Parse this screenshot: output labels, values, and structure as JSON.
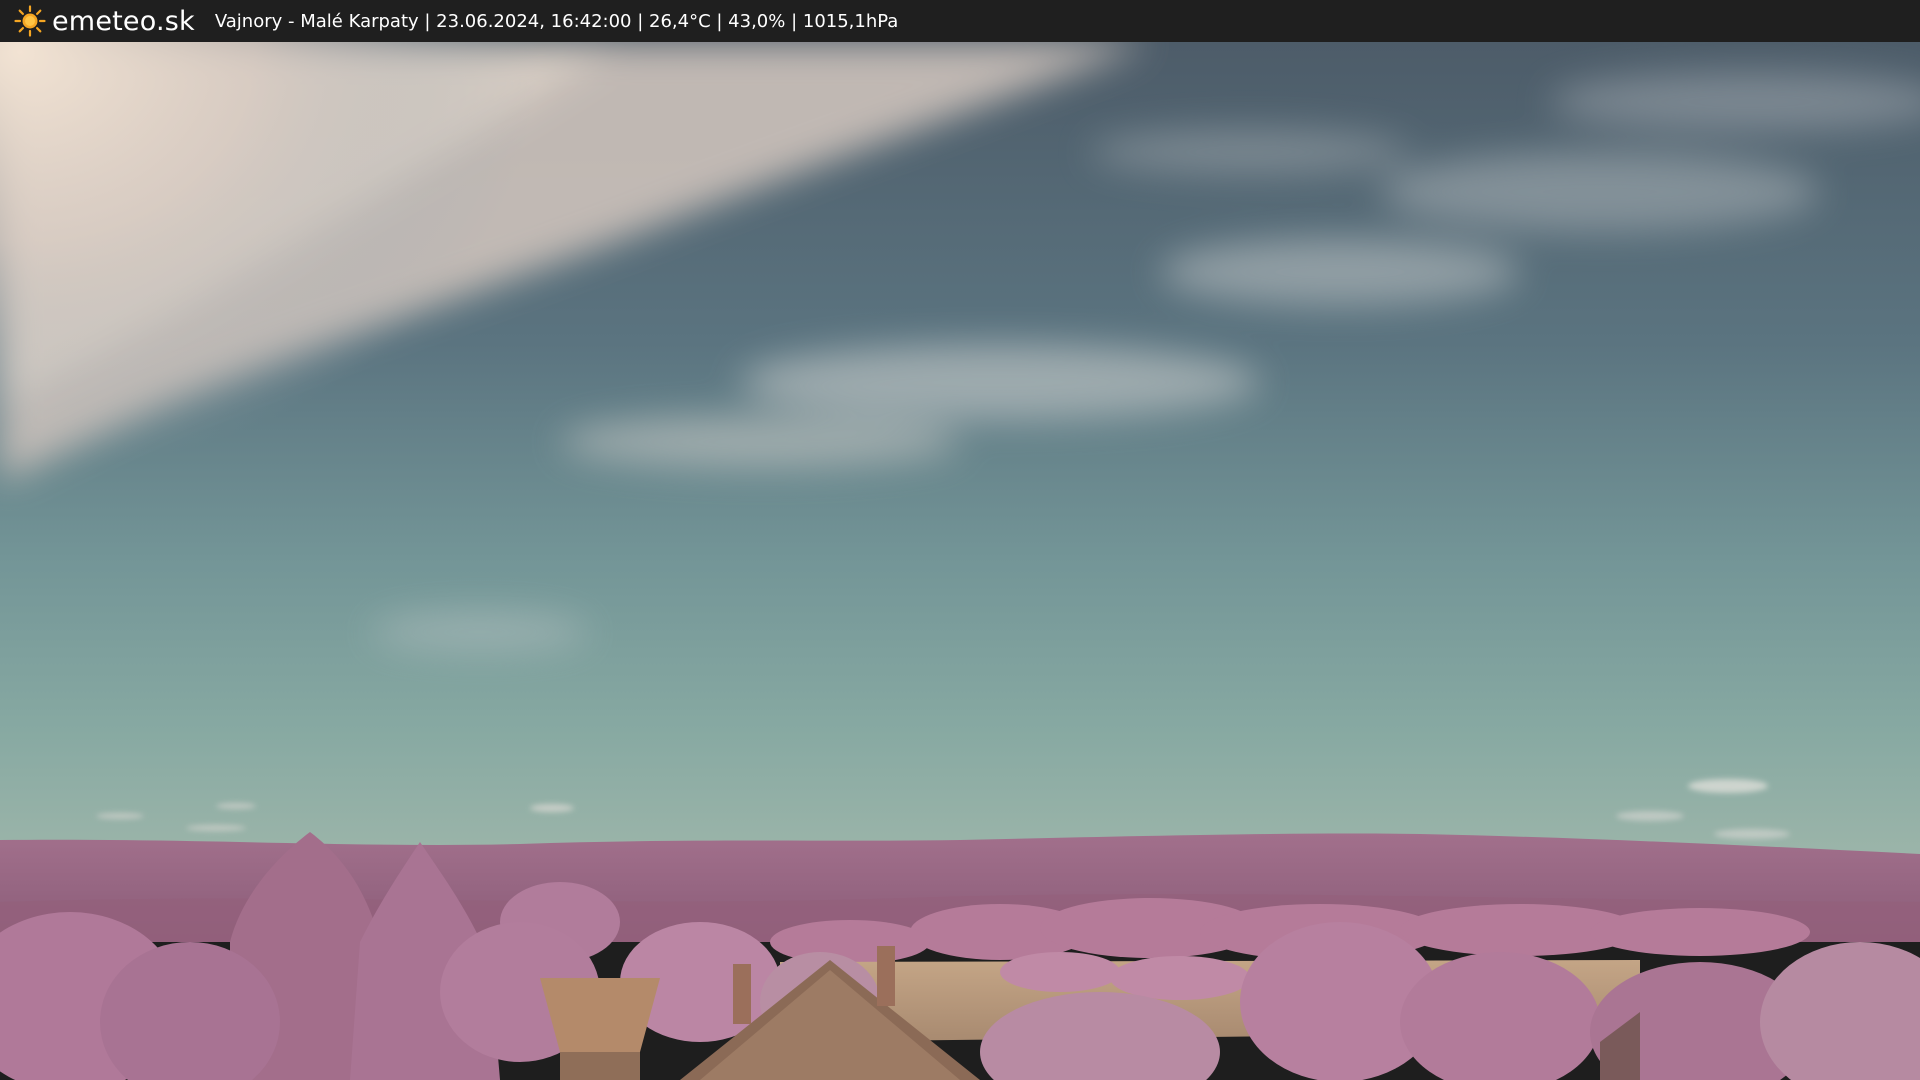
{
  "header": {
    "logo_icon": "sun-icon",
    "brand": "emeteo.sk",
    "station_info": "Vajnory - Malé Karpaty | 23.06.2024, 16:42:00 | 26,4°C | 43,0% | 1015,1hPa"
  },
  "colors": {
    "bar_background": "#1f1f1f",
    "sun": "#f5a623",
    "sky_top": "#4f5f6c",
    "sky_horizon": "#86a7a2",
    "vegetation": "#b67d9a",
    "field": "#b99a7c"
  }
}
